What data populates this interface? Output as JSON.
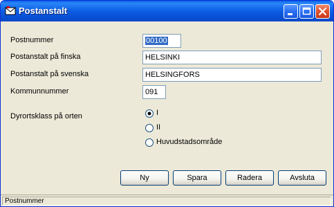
{
  "window": {
    "title": "Postanstalt",
    "icon": "mail-app-icon"
  },
  "form": {
    "postnummer_label": "Postnummer",
    "postnummer_value": "00100",
    "finska_label": "Postanstalt på finska",
    "finska_value": "HELSINKI",
    "svenska_label": "Postanstalt på svenska",
    "svenska_value": "HELSINGFORS",
    "kommun_label": "Kommunnummer",
    "kommun_value": "091",
    "dyrort_label": "Dyrortsklass på orten",
    "options": [
      {
        "label": "I",
        "selected": true
      },
      {
        "label": "II",
        "selected": false
      },
      {
        "label": "Huvudstadsområde",
        "selected": false
      }
    ]
  },
  "buttons": {
    "ny": "Ny",
    "spara": "Spara",
    "radera": "Radera",
    "avsluta": "Avsluta"
  },
  "status": {
    "text": "Postnummer"
  }
}
